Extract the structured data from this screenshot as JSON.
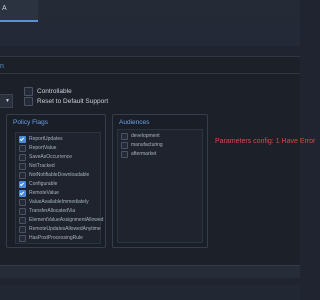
{
  "tab": {
    "label": "A"
  },
  "section": {
    "title": "n"
  },
  "options": [
    {
      "label": "Controllable",
      "checked": false
    },
    {
      "label": "Reset to Default Support",
      "checked": false
    }
  ],
  "policy_flags": {
    "title": "Policy Flags",
    "items": [
      {
        "label": "ReportUpdates",
        "checked": true
      },
      {
        "label": "ReportValue",
        "checked": false
      },
      {
        "label": "SaveAsOccurrence",
        "checked": false
      },
      {
        "label": "NotTracked",
        "checked": false
      },
      {
        "label": "NotNotifiableDownloadable",
        "checked": false
      },
      {
        "label": "Configurable",
        "checked": true
      },
      {
        "label": "RemoteValue",
        "checked": true
      },
      {
        "label": "ValueAvailableImmediately",
        "checked": false
      },
      {
        "label": "TransferAllocatedVia",
        "checked": false
      },
      {
        "label": "ElementValueAssignmentAllowed",
        "checked": false
      },
      {
        "label": "RemoteUpdatesAllowedAnytime",
        "checked": false
      },
      {
        "label": "HasPostProcessingRule",
        "checked": false
      }
    ]
  },
  "audiences": {
    "title": "Audiences",
    "items": [
      {
        "label": "development",
        "checked": false
      },
      {
        "label": "manufacturing",
        "checked": false
      },
      {
        "label": "aftermarket",
        "checked": false
      }
    ]
  },
  "error_text": "Parameters config: 1 Have Error"
}
